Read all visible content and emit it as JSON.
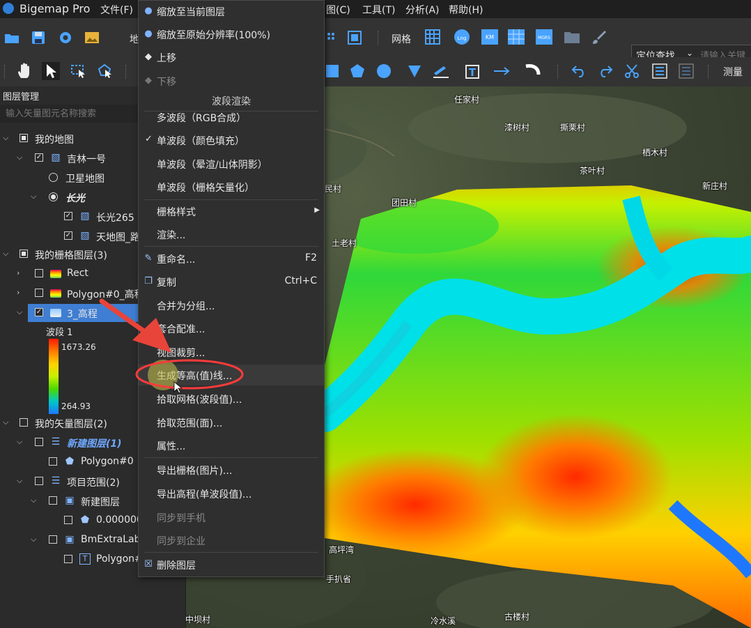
{
  "app": {
    "title": "Bigemap Pro"
  },
  "menubar": {
    "items": [
      "文件(F)",
      "图(C)",
      "工具(T)",
      "分析(A)",
      "帮助(H)"
    ]
  },
  "toolbar": {
    "left_label": "地",
    "grid_label": "网格",
    "grid_buttons": [
      "Lng",
      "KM",
      "MGRS"
    ],
    "locate_button": "定位查找",
    "locate_placeholder": "请输入关键",
    "measure_label": "测量"
  },
  "panel": {
    "title": "图层管理",
    "search_placeholder": "输入矢量图元名称搜索",
    "tree": [
      {
        "label": "我的地图"
      },
      {
        "label": "吉林一号"
      },
      {
        "label": "卫星地图"
      },
      {
        "label": "长光"
      },
      {
        "label": "长光265"
      },
      {
        "label": "天地图_路"
      },
      {
        "label": "我的栅格图层(3)"
      },
      {
        "label": "Rect"
      },
      {
        "label": "Polygon#0_高程"
      },
      {
        "label": "3_高程"
      },
      {
        "label": "我的矢量图层(2)"
      },
      {
        "label": "新建图层(1)"
      },
      {
        "label": "Polygon#0"
      },
      {
        "label": "项目范围(2)"
      },
      {
        "label": "新建图层"
      },
      {
        "label": "0.000000"
      },
      {
        "label": "BmExtraLabe"
      },
      {
        "label": "Polygon#"
      }
    ],
    "legend": {
      "band": "波段 1",
      "max": "1673.26",
      "min": "264.93"
    }
  },
  "context_menu": {
    "items": [
      {
        "label": "缩放至当前图层"
      },
      {
        "label": "缩放至原始分辨率(100%)"
      },
      {
        "label": "上移"
      },
      {
        "label": "下移"
      },
      {
        "label": "波段渲染"
      },
      {
        "label": "多波段（RGB合成）"
      },
      {
        "label": "单波段（颜色填充）"
      },
      {
        "label": "单波段（晕渲/山体阴影）"
      },
      {
        "label": "单波段（栅格矢量化）"
      },
      {
        "label": "栅格样式"
      },
      {
        "label": "渲染..."
      },
      {
        "label": "重命名...",
        "shortcut": "F2"
      },
      {
        "label": "复制",
        "shortcut": "Ctrl+C"
      },
      {
        "label": "合并为分组..."
      },
      {
        "label": "套合配准..."
      },
      {
        "label": "视图裁剪..."
      },
      {
        "label": "生成等高(值)线..."
      },
      {
        "label": "拾取网格(波段值)..."
      },
      {
        "label": "拾取范围(面)..."
      },
      {
        "label": "属性..."
      },
      {
        "label": "导出栅格(图片)..."
      },
      {
        "label": "导出高程(单波段值)..."
      },
      {
        "label": "同步到手机"
      },
      {
        "label": "同步到企业"
      },
      {
        "label": "删除图层"
      }
    ]
  },
  "map": {
    "places": [
      "任家村",
      "漆树村",
      "撕栗村",
      "栖木村",
      "茶叶村",
      "民村",
      "团田村",
      "新庄村",
      "土老村",
      "高坪湾",
      "手扒省",
      "中坝村",
      "冷水溪",
      "古楼村"
    ]
  },
  "colors": {
    "accent": "#3f7ed2",
    "annotation": "#e8443a",
    "highlight_circle": "#ff3b3b"
  }
}
